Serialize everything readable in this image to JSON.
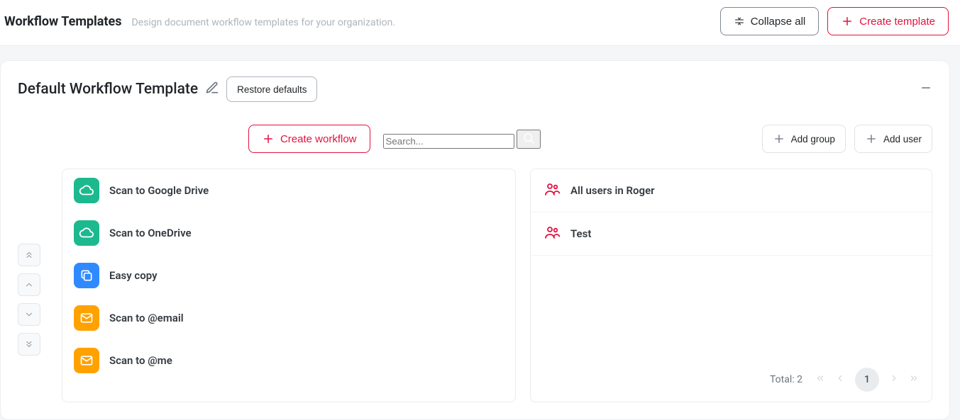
{
  "header": {
    "title": "Workflow Templates",
    "subtitle": "Design document workflow templates for your organization.",
    "collapse_label": "Collapse all",
    "create_label": "Create template"
  },
  "template": {
    "name": "Default Workflow Template",
    "restore_label": "Restore defaults",
    "create_workflow_label": "Create workflow",
    "search_placeholder": "Search...",
    "add_group_label": "Add group",
    "add_user_label": "Add user"
  },
  "workflows": [
    {
      "label": "Scan to Google Drive",
      "icon": "cloud",
      "color": "green"
    },
    {
      "label": "Scan to OneDrive",
      "icon": "cloud",
      "color": "green"
    },
    {
      "label": "Easy copy",
      "icon": "copy",
      "color": "blue"
    },
    {
      "label": "Scan to @email",
      "icon": "envelope",
      "color": "orange"
    },
    {
      "label": "Scan to @me",
      "icon": "envelope",
      "color": "orange"
    }
  ],
  "groups": [
    {
      "label": "All users in Roger"
    },
    {
      "label": "Test"
    }
  ],
  "pager": {
    "total_label": "Total: 2",
    "current": "1"
  }
}
